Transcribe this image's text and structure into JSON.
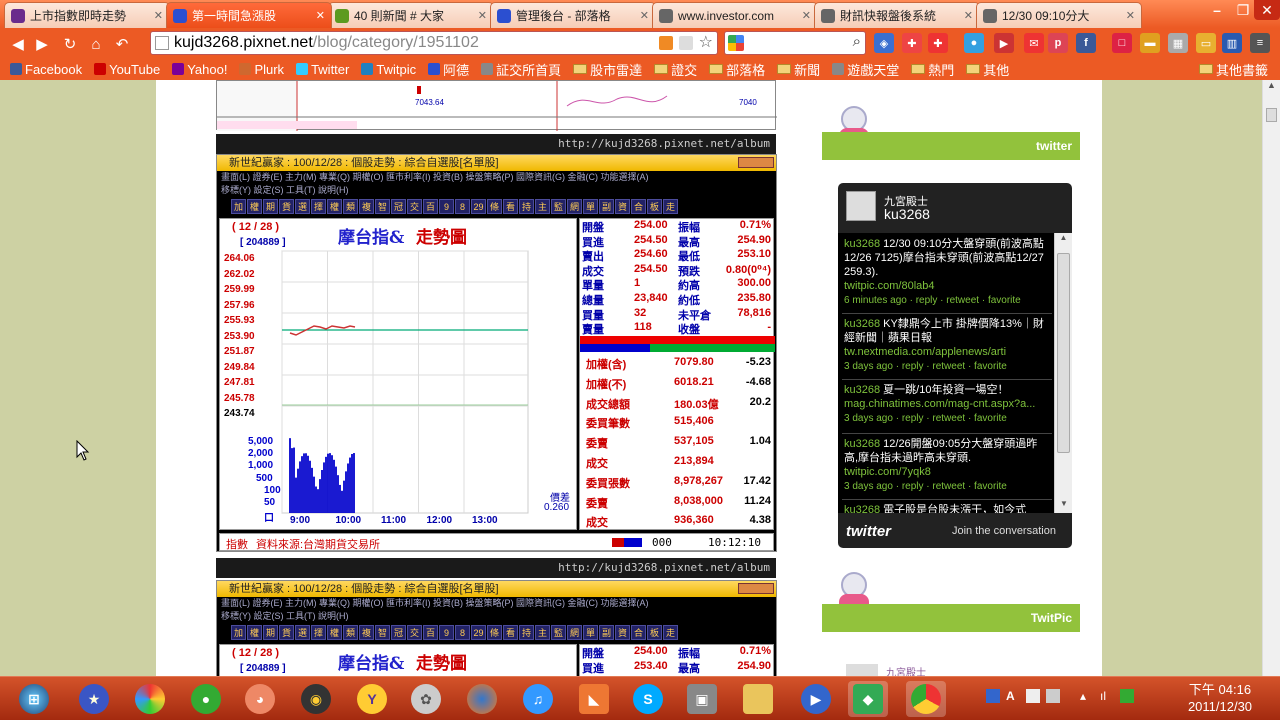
{
  "tabs": [
    {
      "label": "上市指數即時走勢",
      "icon_color": "#6a2c8c",
      "active": false
    },
    {
      "label": "第一時間急漲股",
      "icon_color": "#2b4fd0",
      "active": true
    },
    {
      "label": "40 則新聞 # 大家",
      "icon_color": "#5c9a20",
      "active": false
    },
    {
      "label": "管理後台 - 部落格",
      "icon_color": "#2b4fd0",
      "active": false
    },
    {
      "label": "www.investor.com",
      "icon_color": "#666666",
      "active": false
    },
    {
      "label": "財訊快報盤後系統",
      "icon_color": "#666666",
      "active": false
    },
    {
      "label": "12/30 09:10分大",
      "icon_color": "#666666",
      "active": false
    }
  ],
  "address": {
    "host": "kujd3268.pixnet.net",
    "path": "/blog/category/1951102"
  },
  "bookmarks": [
    {
      "label": "Facebook",
      "type": "site",
      "color": "#3b5998"
    },
    {
      "label": "YouTube",
      "type": "site",
      "color": "#cc0000"
    },
    {
      "label": "Yahoo!",
      "type": "site",
      "color": "#7b0099"
    },
    {
      "label": "Plurk",
      "type": "site",
      "color": "#cf682f"
    },
    {
      "label": "Twitter",
      "type": "site",
      "color": "#33ccff"
    },
    {
      "label": "Twitpic",
      "type": "site",
      "color": "#2080c0"
    },
    {
      "label": "阿德",
      "type": "site",
      "color": "#2b4fd0"
    },
    {
      "label": "証交所首頁",
      "type": "site",
      "color": "#888888"
    },
    {
      "label": "股市雷達",
      "type": "folder"
    },
    {
      "label": "證交",
      "type": "folder"
    },
    {
      "label": "部落格",
      "type": "folder"
    },
    {
      "label": "新聞",
      "type": "folder"
    },
    {
      "label": "遊戲天堂",
      "type": "site",
      "color": "#888888"
    },
    {
      "label": "熱門",
      "type": "folder"
    },
    {
      "label": "其他",
      "type": "folder"
    },
    {
      "label": "其他書籤",
      "type": "folder"
    }
  ],
  "album_url": "http://kujd3268.pixnet.net/album",
  "stock": {
    "title": "新世紀贏家 : 100/12/28 : 個股走勢 : 綜合自選股[名單股]",
    "menu1": "畫面(L)  證券(E)  主力(M)  專業(Q)  期權(O)  匯市利率(I)  投資(B)  操盤策略(P)  國際資訊(G)  金融(C)  功能選擇(A)",
    "menu2": "移標(Y)  設定(S)  工具(T)  說明(H)",
    "tools": [
      "加",
      "權",
      "期",
      "貨",
      "選",
      "擇",
      "權",
      "類",
      "複",
      "智",
      "冠",
      "交",
      "百",
      "9",
      "8",
      "29",
      "條",
      "看",
      "持",
      "主",
      "監",
      "網",
      "單",
      "副",
      "資",
      "合",
      "板",
      "走"
    ],
    "date": "( 12 / 28 )",
    "code": "[ 204889 ]",
    "chart_title": "摩台指&",
    "chart_title2": "走勢圖",
    "yticks": [
      "264.06",
      "262.02",
      "259.99",
      "257.96",
      "255.93",
      "253.90",
      "251.87",
      "249.84",
      "247.81",
      "245.78",
      "243.74"
    ],
    "vticks": [
      "5,000",
      "2,000",
      "1,000",
      "500",
      "100",
      "50",
      "口"
    ],
    "xticks": [
      "9:00",
      "10:00",
      "11:00",
      "12:00",
      "13:00"
    ],
    "vol_label": "價差",
    "vol_value": "0.260",
    "quotes_left": [
      {
        "k": "開盤",
        "v": "254.00",
        "k2": "振幅",
        "v2": "0.71%"
      },
      {
        "k": "買進",
        "v": "254.50",
        "k2": "最高",
        "v2": "254.90"
      },
      {
        "k": "賣出",
        "v": "254.60",
        "k2": "最低",
        "v2": "253.10"
      },
      {
        "k": "成交",
        "v": "254.50",
        "k2": "預跌",
        "v2": "0.80(0⁰⁴)"
      },
      {
        "k": "單量",
        "v": "1",
        "k2": "約高",
        "v2": "300.00"
      },
      {
        "k": "總量",
        "v": "23,840",
        "k2": "約低",
        "v2": "235.80"
      },
      {
        "k": "買量",
        "v": "32",
        "k2": "未平倉",
        "v2": "78,816"
      },
      {
        "k": "賣量",
        "v": "118",
        "k2": "收盤",
        "v2": "-"
      }
    ],
    "quotes_right": [
      {
        "k": "加權(含)",
        "v": "7079.80",
        "c": "-5.23"
      },
      {
        "k": "加權(不)",
        "v": "6018.21",
        "c": "-4.68"
      },
      {
        "k": "成交總額",
        "v": "180.03億",
        "c": "20.2"
      },
      {
        "k": "委買筆數",
        "v": "515,406",
        "c": ""
      },
      {
        "k": "委賣",
        "v": "537,105",
        "c": "1.04"
      },
      {
        "k": "成交",
        "v": "213,894",
        "c": ""
      },
      {
        "k": "委買張數",
        "v": "8,978,267",
        "c": "17.42"
      },
      {
        "k": "委賣",
        "v": "8,038,000",
        "c": "11.24"
      },
      {
        "k": "成交",
        "v": "936,360",
        "c": "4.38"
      }
    ],
    "status_left": "指數",
    "status_src": "資料來源:台灣期貨交易所",
    "status_count": "000",
    "status_time": "10:12:10",
    "top_index": "7043.64",
    "top_index2": "7040",
    "chart2_quotes": [
      {
        "k": "開盤",
        "v": "254.00",
        "k2": "振幅",
        "v2": "0.71%"
      },
      {
        "k": "買進",
        "v": "253.40",
        "k2": "最高",
        "v2": "254.90"
      }
    ]
  },
  "twitter": {
    "bar_label": "twitter",
    "user_name": "九宮殿士",
    "user_handle": "ku3268",
    "tweets": [
      {
        "user": "ku3268",
        "text": " 12/30 09:10分大盤穿頭(前波高點12/26 7125)摩台指未穿頭(前波高點12/27 259.3).",
        "link": "twitpic.com/80lab4",
        "meta": "6 minutes ago · reply · retweet · favorite"
      },
      {
        "user": "ku3268",
        "text": " KY隸鼎今上市 掛牌價降13%｜財經新聞｜蘋果日報",
        "link": "tw.nextmedia.com/applenews/arti",
        "meta": "3 days ago · reply · retweet · favorite"
      },
      {
        "user": "ku3268",
        "text": " 夏一跳/10年投資一場空！",
        "link": "mag.chinatimes.com/mag-cnt.aspx?a...",
        "meta": "3 days ago · reply · retweet · favorite"
      },
      {
        "user": "ku3268",
        "text": " 12/26開盤09:05分大盤穿頭過昨高,摩台指未過昨高未穿頭.",
        "link": "twitpic.com/7yqk8",
        "meta": "3 days ago · reply · retweet · favorite"
      },
      {
        "user": "ku3268",
        "text": " 電子股是台股未漲干，如今式",
        "link": "",
        "meta": ""
      }
    ],
    "footer_logo": "twitter",
    "footer_join": "Join the conversation"
  },
  "twitpic": {
    "bar_label": "TwitPic",
    "user_name": "九宮殿士"
  },
  "clock": {
    "time": "下午 04:16",
    "date": "2011/12/30"
  }
}
